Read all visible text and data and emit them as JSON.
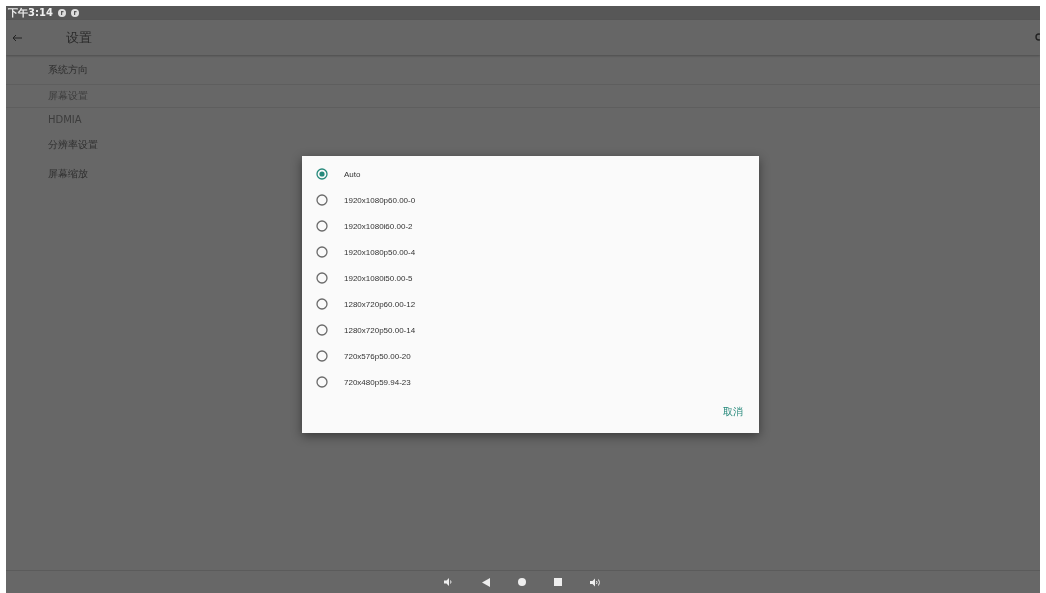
{
  "status_bar": {
    "time": "下午3:14"
  },
  "app_bar": {
    "title": "设置"
  },
  "settings": [
    {
      "kind": "item",
      "label": "系统方向"
    },
    {
      "kind": "category",
      "label": "屏幕设置"
    },
    {
      "kind": "category",
      "label": "HDMIA"
    },
    {
      "kind": "item",
      "label": "分辨率设置"
    },
    {
      "kind": "item",
      "label": "屏幕缩放"
    }
  ],
  "dialog": {
    "options": [
      {
        "label": "Auto",
        "selected": true
      },
      {
        "label": "1920x1080p60.00-0",
        "selected": false
      },
      {
        "label": "1920x1080i60.00-2",
        "selected": false
      },
      {
        "label": "1920x1080p50.00-4",
        "selected": false
      },
      {
        "label": "1920x1080i50.00-5",
        "selected": false
      },
      {
        "label": "1280x720p60.00-12",
        "selected": false
      },
      {
        "label": "1280x720p50.00-14",
        "selected": false
      },
      {
        "label": "720x576p50.00-20",
        "selected": false
      },
      {
        "label": "720x480p59.94-23",
        "selected": false
      }
    ],
    "cancel": "取消"
  }
}
